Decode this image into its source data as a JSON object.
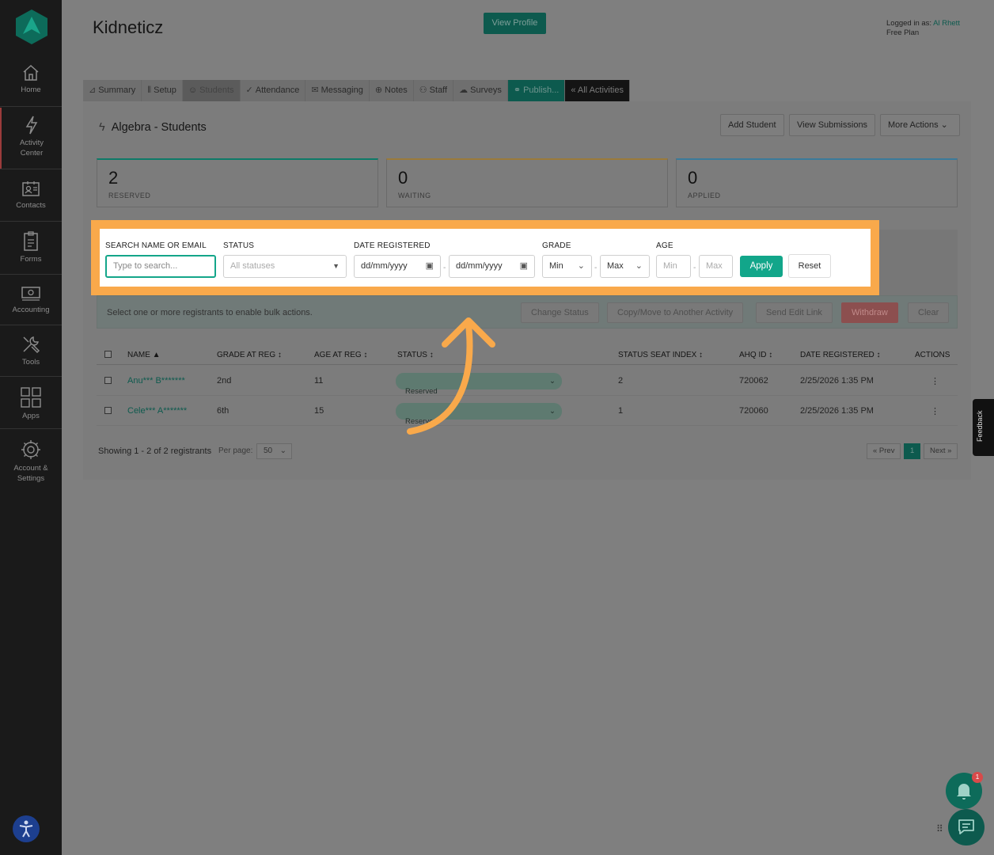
{
  "sidebar": {
    "items": [
      {
        "label": "Home",
        "icon": "home-icon"
      },
      {
        "label": "Activity Center",
        "icon": "bolt-icon"
      },
      {
        "label": "Contacts",
        "icon": "contacts-icon"
      },
      {
        "label": "Forms",
        "icon": "forms-icon"
      },
      {
        "label": "Accounting",
        "icon": "accounting-icon"
      },
      {
        "label": "Tools",
        "icon": "tools-icon"
      },
      {
        "label": "Apps",
        "icon": "apps-icon"
      },
      {
        "label": "Account & Settings",
        "icon": "gear-icon"
      }
    ]
  },
  "header": {
    "title": "Kidneticz",
    "view_profile": "View Profile",
    "logged_in_prefix": "Logged in as:",
    "user": "Al Rhett",
    "plan": "Free Plan"
  },
  "tabs": [
    "Summary",
    "Setup",
    "Students",
    "Attendance",
    "Messaging",
    "Notes",
    "Staff",
    "Surveys",
    "Publish...",
    "« All Activities"
  ],
  "panel": {
    "title": "Algebra - Students",
    "add_student": "Add Student",
    "view_submissions": "View Submissions",
    "more_actions": "More Actions"
  },
  "stats": [
    {
      "value": "2",
      "label": "RESERVED",
      "color": "#0d7a68"
    },
    {
      "value": "0",
      "label": "WAITING",
      "color": "#9a7a3a"
    },
    {
      "value": "0",
      "label": "APPLIED",
      "color": "#3a7a9a"
    }
  ],
  "filters": {
    "search_label": "SEARCH NAME OR EMAIL",
    "search_placeholder": "Type to search...",
    "status_label": "STATUS",
    "status_placeholder": "All statuses",
    "date_label": "DATE REGISTERED",
    "date_from": "dd/mm/yyyy",
    "date_to": "dd/mm/yyyy",
    "grade_label": "GRADE",
    "grade_min": "Min",
    "grade_max": "Max",
    "age_label": "AGE",
    "age_min": "Min",
    "age_max": "Max",
    "apply": "Apply",
    "reset": "Reset"
  },
  "bulk": {
    "text": "Select one or more registrants to enable bulk actions.",
    "change_status": "Change Status",
    "copy_move": "Copy/Move to Another Activity",
    "send_edit_link": "Send Edit Link",
    "withdraw": "Withdraw",
    "clear": "Clear"
  },
  "table": {
    "headers": [
      "NAME ▲",
      "GRADE AT REG ↕",
      "AGE AT REG ↕",
      "STATUS ↕",
      "STATUS SEAT INDEX ↕",
      "AHQ ID ↕",
      "DATE REGISTERED ↕",
      "ACTIONS"
    ],
    "rows": [
      {
        "name": "Anu*** B*******",
        "grade": "2nd",
        "age": "11",
        "status": "Reserved",
        "seat": "2",
        "ahq": "720062",
        "date": "2/25/2026 1:35 PM",
        "actions": "⋮"
      },
      {
        "name": "Cele*** A*******",
        "grade": "6th",
        "age": "15",
        "status": "Reserved",
        "seat": "1",
        "ahq": "720060",
        "date": "2/25/2026 1:35 PM",
        "actions": "⋮"
      }
    ]
  },
  "footer": {
    "showing": "Showing 1 - 2 of 2 registrants",
    "per_page_label": "Per page:",
    "per_page": "50",
    "prev": "« Prev",
    "page": "1",
    "next": "Next »"
  },
  "widgets": {
    "feedback": "Feedback",
    "notification_count": "1"
  }
}
